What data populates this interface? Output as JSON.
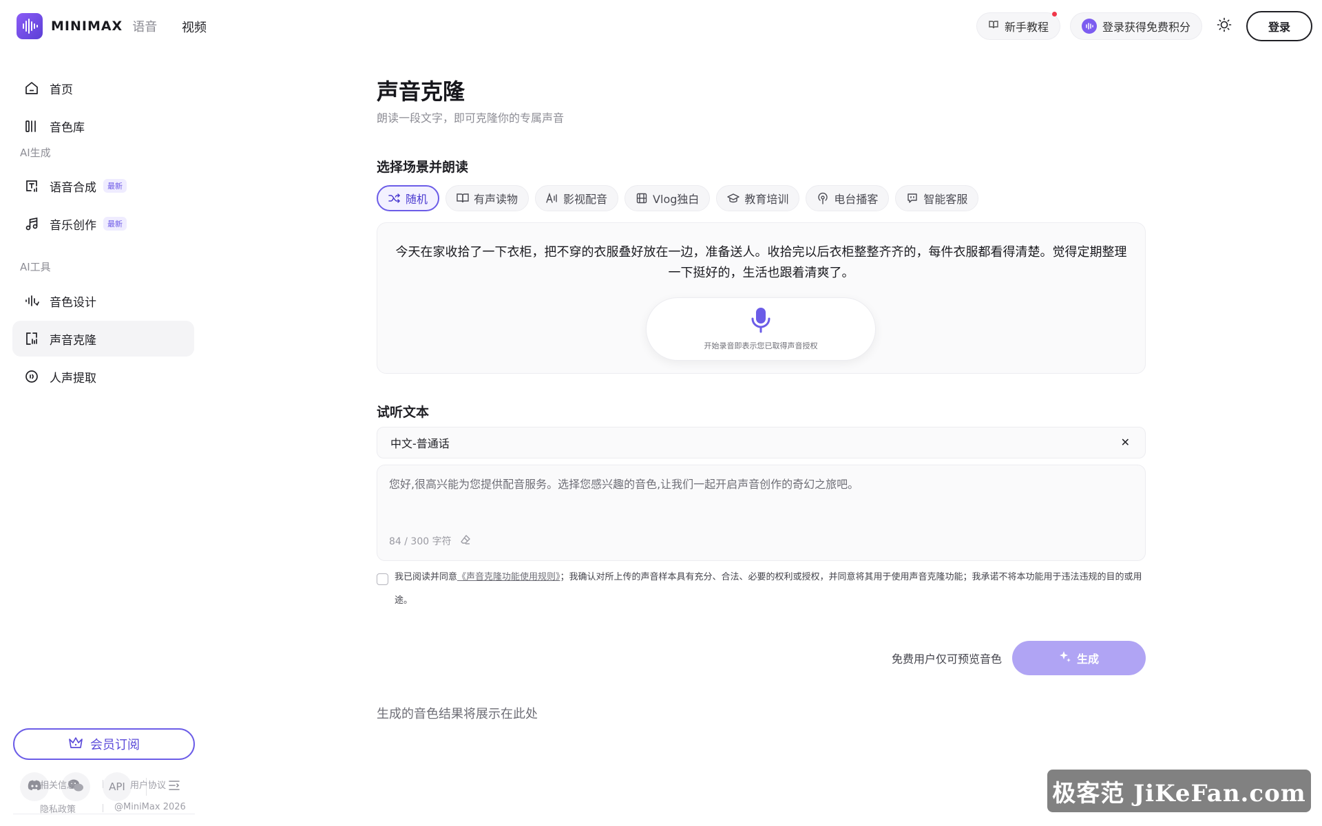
{
  "header": {
    "brand": "MINIMAX",
    "brand_sub": "语音",
    "nav_video": "视频",
    "tutorial": "新手教程",
    "credits": "登录获得免费积分",
    "login": "登录"
  },
  "sidebar": {
    "items": [
      {
        "label": "首页",
        "icon": "home-icon"
      },
      {
        "label": "音色库",
        "icon": "library-icon"
      }
    ],
    "section_ai_gen": "AI生成",
    "gen_items": [
      {
        "label": "语音合成",
        "badge": "最新",
        "icon": "speech-synthesis-icon"
      },
      {
        "label": "音乐创作",
        "badge": "最新",
        "icon": "music-icon"
      }
    ],
    "section_ai_tools": "AI工具",
    "tool_items": [
      {
        "label": "音色设计",
        "icon": "voice-design-icon"
      },
      {
        "label": "声音克隆",
        "icon": "voice-clone-icon",
        "active": true
      },
      {
        "label": "人声提取",
        "icon": "vocal-extract-icon"
      }
    ],
    "subscribe": "会员订阅",
    "social": {
      "api": "API"
    },
    "footer": {
      "related": "相关信息",
      "terms": "用户协议",
      "privacy": "隐私政策",
      "copyright": "@MiniMax 2026"
    }
  },
  "main": {
    "title": "声音克隆",
    "subtitle": "朗读一段文字，即可克隆你的专属声音",
    "scene_title": "选择场景并朗读",
    "tabs": [
      {
        "label": "随机",
        "icon": "shuffle-icon",
        "active": true
      },
      {
        "label": "有声读物",
        "icon": "book-icon"
      },
      {
        "label": "影视配音",
        "icon": "film-voice-icon"
      },
      {
        "label": "Vlog独白",
        "icon": "vlog-icon"
      },
      {
        "label": "教育培训",
        "icon": "education-icon"
      },
      {
        "label": "电台播客",
        "icon": "podcast-icon"
      },
      {
        "label": "智能客服",
        "icon": "chat-icon"
      }
    ],
    "read_text": "今天在家收拾了一下衣柜，把不穿的衣服叠好放在一边，准备送人。收拾完以后衣柜整整齐齐的，每件衣服都看得清楚。觉得定期整理一下挺好的，生活也跟着清爽了。",
    "record_note": "开始录音即表示您已取得声音授权",
    "preview_title": "试听文本",
    "language": "中文-普通话",
    "preview_text": "您好,很高兴能为您提供配音服务。选择您感兴趣的音色,让我们一起开启声音创作的奇幻之旅吧。",
    "char_count": "84 / 300 字符",
    "agree_prefix": "我已阅读并同意",
    "agree_link": "《声音克隆功能使用规则》",
    "agree_suffix": "；我确认对所上传的声音样本具有充分、合法、必要的权利或授权，并同意将其用于使用声音克隆功能；我承诺不将本功能用于违法违规的目的或用途。",
    "free_note": "免费用户仅可预览音色",
    "generate": "生成",
    "result_hint": "生成的音色结果将展示在此处"
  },
  "watermark": "极客范 JiKeFan.com",
  "colors": {
    "accent": "#6b5ce7",
    "generate_button": "#b0a4f4",
    "brand": "#7c5cf0"
  }
}
